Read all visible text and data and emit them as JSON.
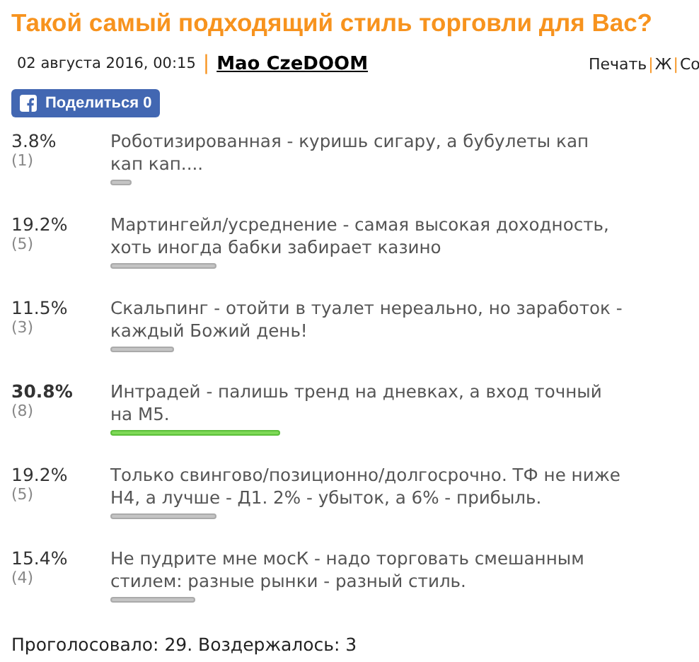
{
  "title": "Такой самый подходящий стиль торговли для Вас?",
  "meta": {
    "date": "02 августа 2016, 00:15",
    "separator": "|",
    "author": "Mao CzeDOOM",
    "links": [
      "Печать",
      "Ж",
      "Со"
    ]
  },
  "share_button": {
    "label": "Поделиться 0"
  },
  "options": [
    {
      "percent": "3.8%",
      "count": "(1)",
      "text": "Роботизированная - куришь сигару, а бубулеты кап кап кап....",
      "leading": false
    },
    {
      "percent": "19.2%",
      "count": "(5)",
      "text": "Мартингейл/усреднение - самая высокая доходность, хоть иногда бабки забирает казино",
      "leading": false
    },
    {
      "percent": "11.5%",
      "count": "(3)",
      "text": "Скальпинг - отойти в туалет нереально, но заработок - каждый Божий день!",
      "leading": false
    },
    {
      "percent": "30.8%",
      "count": "(8)",
      "text": "Интрадей - палишь тренд на дневках, а вход точный на М5.",
      "leading": true
    },
    {
      "percent": "19.2%",
      "count": "(5)",
      "text": "Только свингово/позиционно/долгосрочно. ТФ не ниже Н4, а лучше - Д1. 2% - убыток, а 6% - прибыль.",
      "leading": false
    },
    {
      "percent": "15.4%",
      "count": "(4)",
      "text": "Не пудрите мне мосК - надо торговать смешанным стилем: разные рынки - разный стиль.",
      "leading": false
    }
  ],
  "summary": "Проголосовало: 29. Воздержалось: 3"
}
